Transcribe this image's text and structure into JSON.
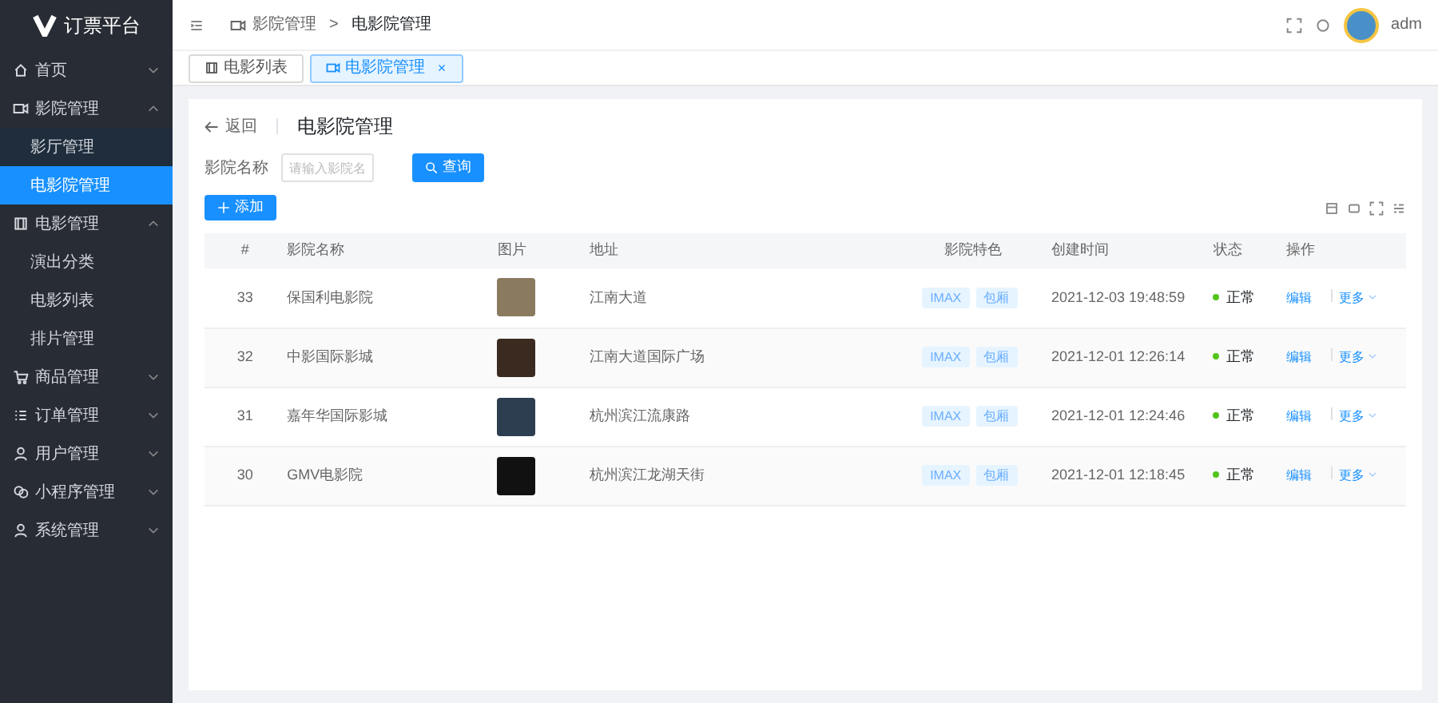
{
  "sidebar": {
    "logo_text": "订票平台",
    "items": [
      {
        "label": "首页",
        "expanded": false,
        "selected": false
      },
      {
        "label": "影院管理",
        "expanded": true,
        "selected": false,
        "children": [
          {
            "label": "影厅管理",
            "selected": false
          },
          {
            "label": "电影院管理",
            "selected": true
          }
        ]
      },
      {
        "label": "电影管理",
        "expanded": true,
        "selected": false,
        "children": [
          {
            "label": "演出分类",
            "selected": false
          },
          {
            "label": "电影列表",
            "selected": false
          },
          {
            "label": "排片管理",
            "selected": false
          }
        ]
      },
      {
        "label": "商品管理",
        "expanded": false,
        "selected": false
      },
      {
        "label": "订单管理",
        "expanded": false,
        "selected": false
      },
      {
        "label": "用户管理",
        "expanded": false,
        "selected": false
      },
      {
        "label": "小程序管理",
        "expanded": false,
        "selected": false
      },
      {
        "label": "系统管理",
        "expanded": false,
        "selected": false
      }
    ]
  },
  "header": {
    "breadcrumb": [
      "影院管理",
      "电影院管理"
    ],
    "separator": ">",
    "user": "adm"
  },
  "tabs": [
    {
      "label": "电影列表",
      "selected": false,
      "closable": false
    },
    {
      "label": "电影院管理",
      "selected": true,
      "closable": true
    }
  ],
  "page": {
    "back": "返回",
    "title": "电影院管理",
    "search": {
      "label": "影院名称",
      "placeholder": "请输入影院名",
      "button": "查询"
    },
    "add_button": "添加",
    "table": {
      "columns": [
        "#",
        "影院名称",
        "图片",
        "地址",
        "影院特色",
        "创建时间",
        "状态",
        "操作"
      ],
      "rows": [
        {
          "id": "33",
          "name": "保国利电影院",
          "address": "江南大道",
          "tags": [
            "IMAX",
            "包厢"
          ],
          "created": "2021-12-03 19:48:59",
          "status": {
            "text": "正常",
            "color": "#52c41a"
          },
          "edit": "编辑",
          "more": "更多"
        },
        {
          "id": "32",
          "name": "中影国际影城",
          "address": "江南大道国际广场",
          "tags": [
            "IMAX",
            "包厢"
          ],
          "created": "2021-12-01 12:26:14",
          "status": {
            "text": "正常",
            "color": "#52c41a"
          },
          "edit": "编辑",
          "more": "更多"
        },
        {
          "id": "31",
          "name": "嘉年华国际影城",
          "address": "杭州滨江流康路",
          "tags": [
            "IMAX",
            "包厢"
          ],
          "created": "2021-12-01 12:24:46",
          "status": {
            "text": "正常",
            "color": "#52c41a"
          },
          "edit": "编辑",
          "more": "更多"
        },
        {
          "id": "30",
          "name": "GMV电影院",
          "address": "杭州滨江龙湖天街",
          "tags": [
            "IMAX",
            "包厢"
          ],
          "created": "2021-12-01 12:18:45",
          "status": {
            "text": "正常",
            "color": "#52c41a"
          },
          "edit": "编辑",
          "more": "更多"
        }
      ]
    }
  }
}
